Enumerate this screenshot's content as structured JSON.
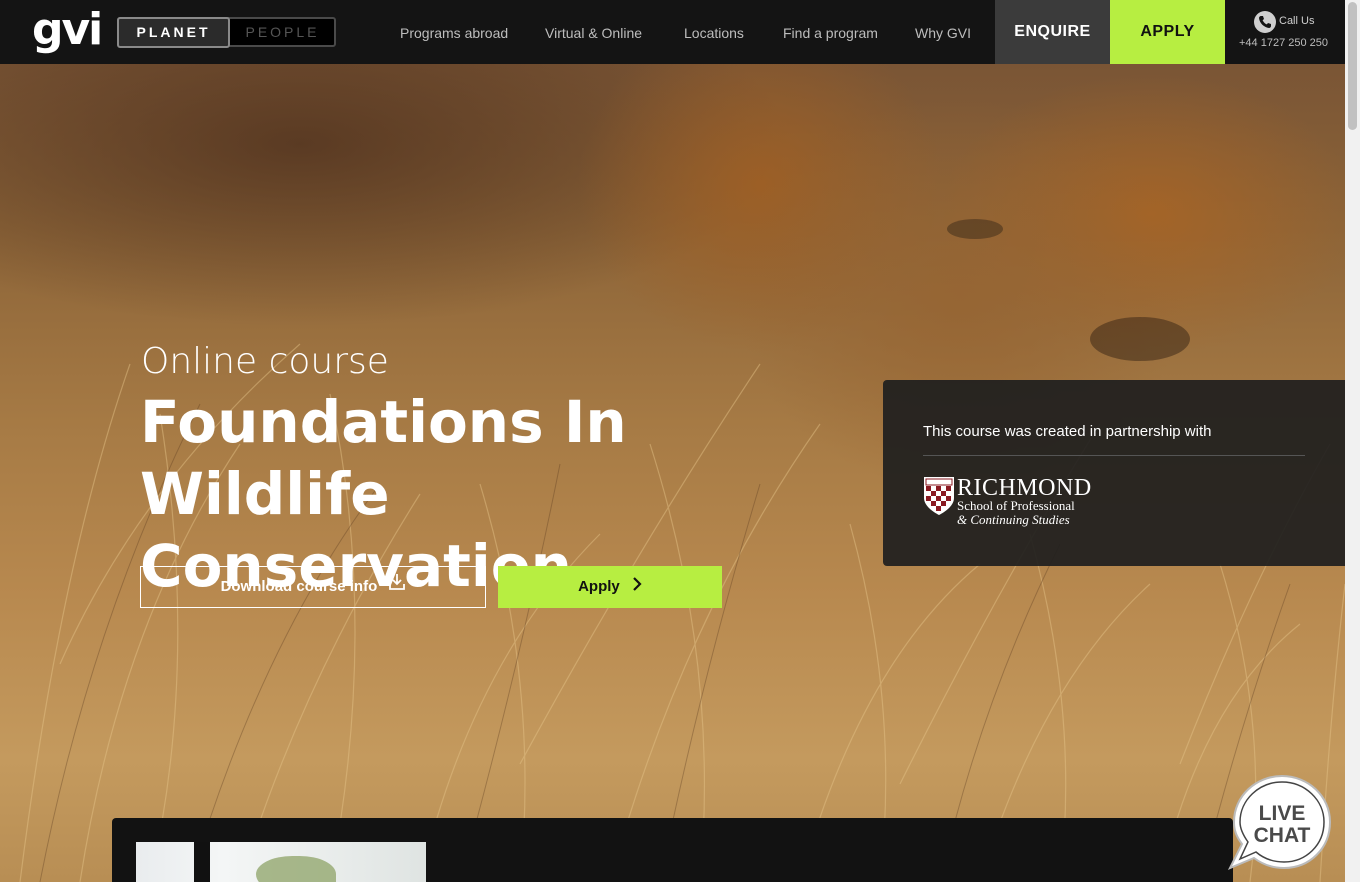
{
  "header": {
    "logo": "gvi",
    "toggle": {
      "active": "PLANET",
      "inactive": "PEOPLE"
    },
    "nav": [
      "Programs abroad",
      "Virtual & Online",
      "Locations",
      "Find a program",
      "Why GVI"
    ],
    "enquire": "ENQUIRE",
    "apply": "APPLY",
    "call": {
      "label": "Call Us",
      "number": "+44 1727 250 250"
    }
  },
  "hero": {
    "subtitle": "Online course",
    "title": "Foundations In Wildlife Conservation",
    "download_label": "Download course info",
    "apply_label": "Apply"
  },
  "partner": {
    "text": "This course was created in partnership with",
    "logo_name": "RICHMOND",
    "logo_line1": "School of Professional",
    "logo_line2": "& Continuing Studies"
  },
  "livechat": {
    "line1": "LIVE",
    "line2": "CHAT"
  }
}
